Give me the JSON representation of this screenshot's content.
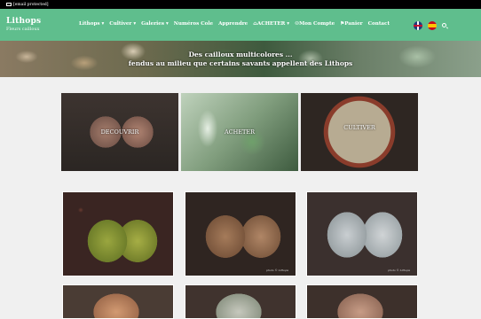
{
  "topbar": {
    "email": "[email protected]"
  },
  "brand": {
    "title": "Lithops",
    "subtitle": "Fleurs cailloux"
  },
  "nav": {
    "items": [
      "Lithops ▾",
      "Cultiver ▾",
      "Galeries ▾",
      "Numéros Cole",
      "Apprendre",
      "⌂ACHETER ▾",
      "☺Mon Compte",
      "⚑Panier",
      "Contact"
    ]
  },
  "hero": {
    "line1": "Des cailloux multicolores ...",
    "line2": "fendus au milieu que certains savants appellent des Lithops"
  },
  "tiles": [
    {
      "label": "DECOUVRIR"
    },
    {
      "label": "ACHETER"
    },
    {
      "label": "CULTIVER"
    }
  ],
  "photos": {
    "credit": "photo © Lithops"
  }
}
